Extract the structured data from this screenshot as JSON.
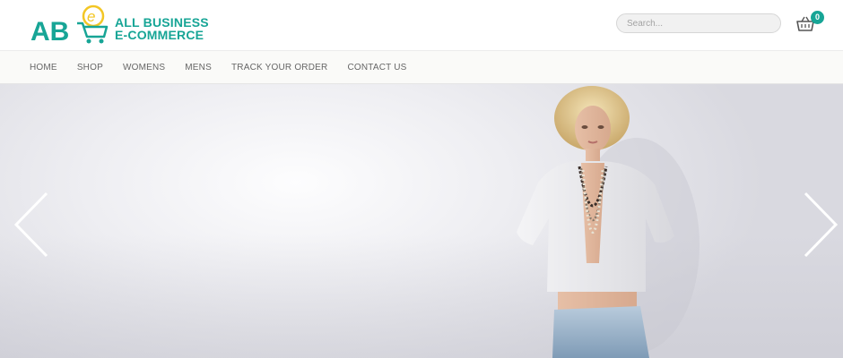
{
  "brand": {
    "mark_text": "AB",
    "mark_accent": "e",
    "name_line1": "ALL BUSINESS",
    "name_line2": "E-COMMERCE",
    "primary_color": "#17a596",
    "accent_color": "#f3c624"
  },
  "search": {
    "placeholder": "Search..."
  },
  "cart": {
    "count": "0",
    "icon": "basket-icon"
  },
  "nav": {
    "items": [
      {
        "label": "HOME"
      },
      {
        "label": "SHOP"
      },
      {
        "label": "WOMENS"
      },
      {
        "label": "MENS"
      },
      {
        "label": "TRACK YOUR ORDER"
      },
      {
        "label": "CONTACT US"
      }
    ]
  },
  "hero": {
    "image": "fashion-model-photo",
    "prev_icon": "chevron-left-icon",
    "next_icon": "chevron-right-icon"
  }
}
